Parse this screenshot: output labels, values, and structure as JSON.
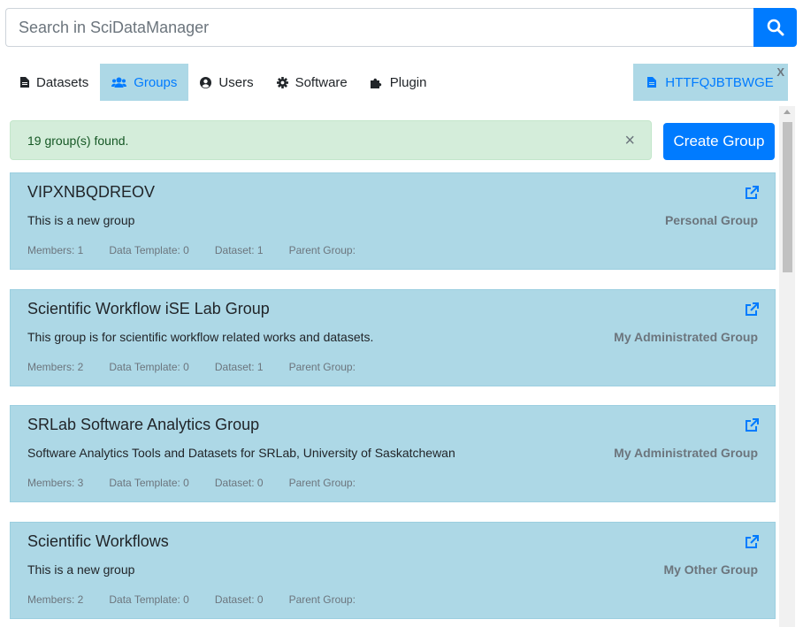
{
  "search": {
    "placeholder": "Search in SciDataManager"
  },
  "tabs": [
    {
      "label": "Datasets",
      "icon": "file-icon"
    },
    {
      "label": "Groups",
      "icon": "users-icon",
      "active": true
    },
    {
      "label": "Users",
      "icon": "user-circle-icon"
    },
    {
      "label": "Software",
      "icon": "gear-icon"
    },
    {
      "label": "Plugin",
      "icon": "puzzle-icon"
    }
  ],
  "open_file_tab": {
    "label": "HTTFQJBTBWGE",
    "close": "X"
  },
  "alert": {
    "message": "19 group(s) found.",
    "close": "×"
  },
  "create_button": "Create Group",
  "groups": [
    {
      "name": "VIPXNBQDREOV",
      "description": "This is a new group",
      "type": "Personal Group",
      "members": "Members: 1",
      "data_template": "Data Template: 0",
      "dataset": "Dataset: 1",
      "parent_group": "Parent Group:"
    },
    {
      "name": "Scientific Workflow iSE Lab Group",
      "description": "This group is for scientific workflow related works and datasets.",
      "type": "My Administrated Group",
      "members": "Members: 2",
      "data_template": "Data Template: 0",
      "dataset": "Dataset: 1",
      "parent_group": "Parent Group:"
    },
    {
      "name": "SRLab Software Analytics Group",
      "description": "Software Analytics Tools and Datasets for SRLab, University of Saskatchewan",
      "type": "My Administrated Group",
      "members": "Members: 3",
      "data_template": "Data Template: 0",
      "dataset": "Dataset: 0",
      "parent_group": "Parent Group:"
    },
    {
      "name": "Scientific Workflows",
      "description": "This is a new group",
      "type": "My Other Group",
      "members": "Members: 2",
      "data_template": "Data Template: 0",
      "dataset": "Dataset: 0",
      "parent_group": "Parent Group:"
    }
  ],
  "colors": {
    "primary": "#007bff",
    "card_bg": "#add8e6",
    "alert_bg": "#d4edda"
  }
}
